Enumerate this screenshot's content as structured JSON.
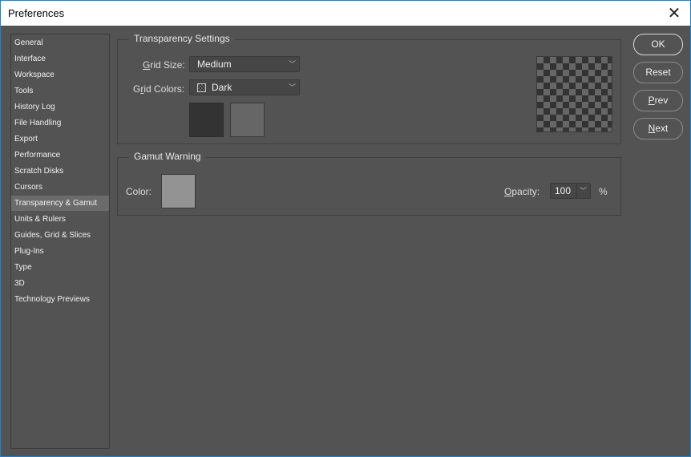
{
  "window": {
    "title": "Preferences"
  },
  "sidebar": {
    "items": [
      "General",
      "Interface",
      "Workspace",
      "Tools",
      "History Log",
      "File Handling",
      "Export",
      "Performance",
      "Scratch Disks",
      "Cursors",
      "Transparency & Gamut",
      "Units & Rulers",
      "Guides, Grid & Slices",
      "Plug-Ins",
      "Type",
      "3D",
      "Technology Previews"
    ],
    "selected": "Transparency & Gamut"
  },
  "transparency": {
    "legend": "Transparency Settings",
    "grid_size_label": "Grid Size:",
    "grid_size_value": "Medium",
    "grid_colors_label": "Grid Colors:",
    "grid_colors_value": "Dark",
    "color1": "#333333",
    "color2": "#666666"
  },
  "gamut": {
    "legend": "Gamut Warning",
    "color_label": "Color:",
    "color": "#939393",
    "opacity_label": "Opacity:",
    "opacity_value": "100",
    "opacity_unit": "%"
  },
  "buttons": {
    "ok": "OK",
    "reset": "Reset",
    "prev": "Prev",
    "next": "Next"
  }
}
